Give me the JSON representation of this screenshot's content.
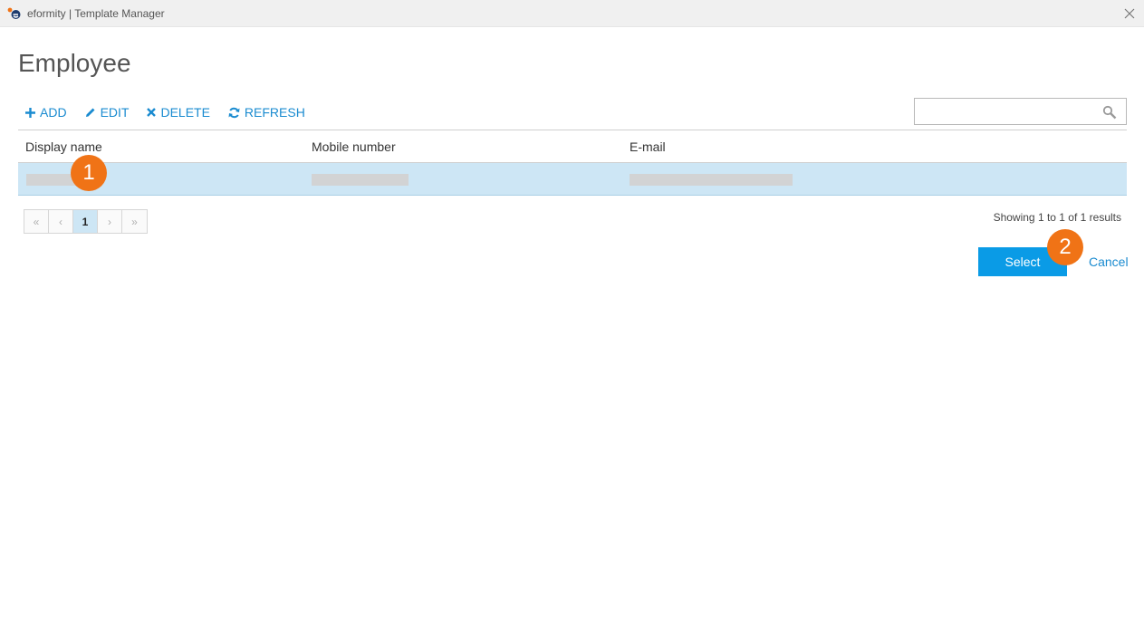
{
  "window": {
    "title": "eformity | Template Manager"
  },
  "page": {
    "title": "Employee"
  },
  "toolbar": {
    "add_label": "ADD",
    "edit_label": "EDIT",
    "delete_label": "DELETE",
    "refresh_label": "REFRESH"
  },
  "search": {
    "value": "",
    "placeholder": ""
  },
  "table": {
    "columns": [
      "Display name",
      "Mobile number",
      "E-mail"
    ],
    "rows": [
      {
        "display_name": "",
        "mobile_number": "",
        "email": "",
        "selected": true
      }
    ]
  },
  "pagination": {
    "first": "«",
    "prev": "‹",
    "current": "1",
    "next": "›",
    "last": "»"
  },
  "results_text": "Showing 1 to 1 of 1 results",
  "actions": {
    "select_label": "Select",
    "cancel_label": "Cancel"
  },
  "callouts": [
    "1",
    "2"
  ],
  "colors": {
    "accent": "#1a8bd0",
    "primary_button": "#0a9be6",
    "selected_row": "#cde6f5",
    "callout": "#f07316"
  }
}
